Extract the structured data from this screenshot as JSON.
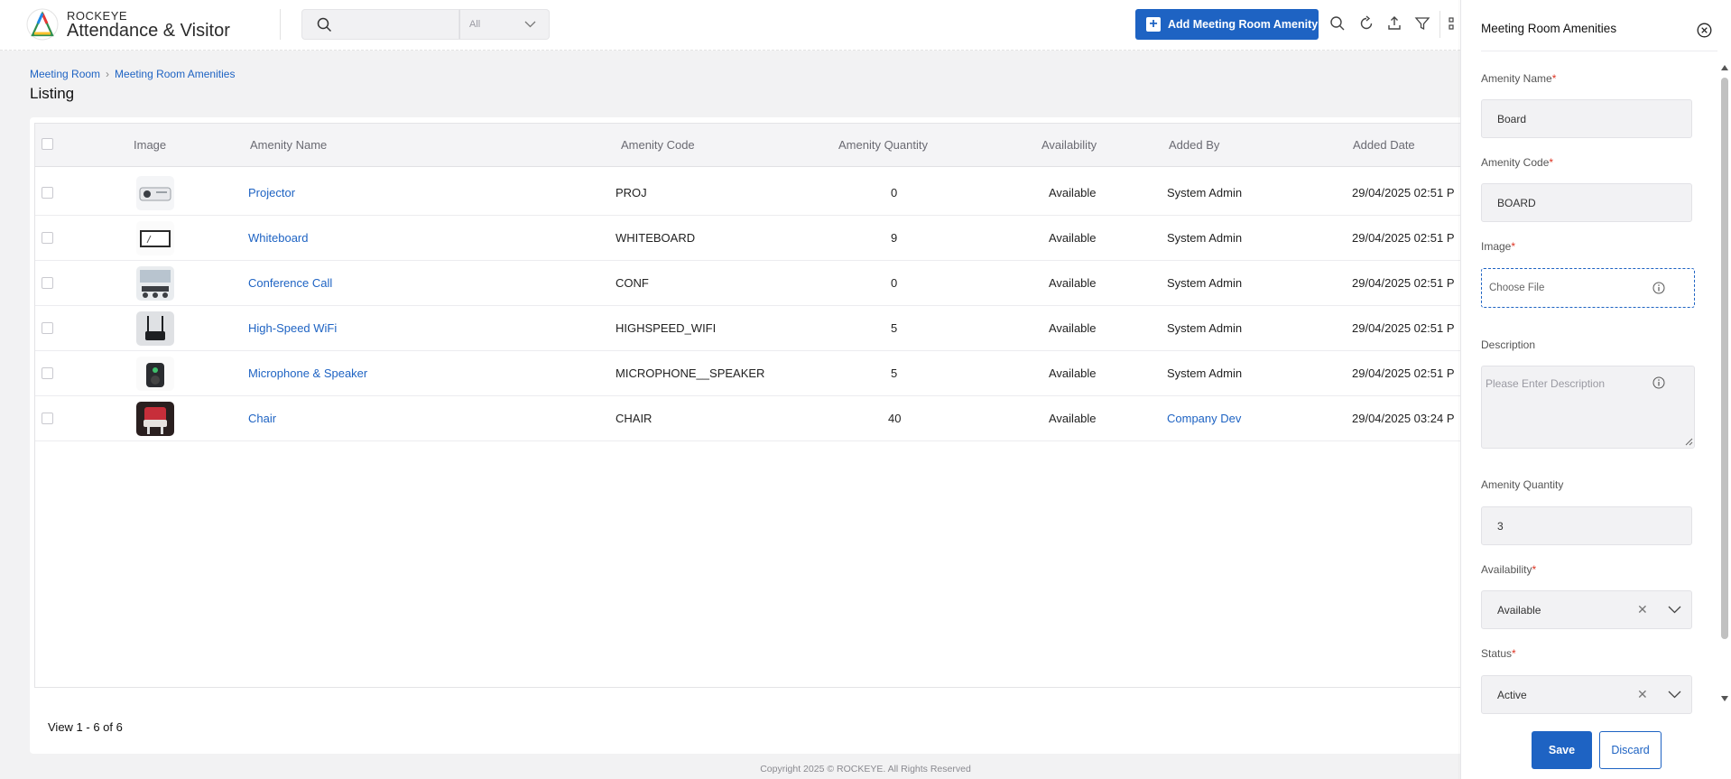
{
  "header": {
    "brand_top": "ROCKEYE",
    "brand_main": "Attendance & Visitor",
    "search_placeholder": "",
    "search_scope": "All",
    "add_button": "Add Meeting Room Amenity"
  },
  "breadcrumb": [
    "Meeting Room",
    "Meeting Room Amenities"
  ],
  "page_title": "Listing",
  "table": {
    "columns": [
      "Image",
      "Amenity Name",
      "Amenity Code",
      "Amenity Quantity",
      "Availability",
      "Added By",
      "Added Date"
    ],
    "rows": [
      {
        "image": "projector-image",
        "name": "Projector",
        "code": "PROJ",
        "quantity": "0",
        "availability": "Available",
        "added_by": "System Admin",
        "added_date": "29/04/2025 02:51 P"
      },
      {
        "image": "whiteboard-image",
        "name": "Whiteboard",
        "code": "WHITEBOARD",
        "quantity": "9",
        "availability": "Available",
        "added_by": "System Admin",
        "added_date": "29/04/2025 02:51 P"
      },
      {
        "image": "conference-call-image",
        "name": "Conference Call",
        "code": "CONF",
        "quantity": "0",
        "availability": "Available",
        "added_by": "System Admin",
        "added_date": "29/04/2025 02:51 P"
      },
      {
        "image": "wifi-router-image",
        "name": "High-Speed WiFi",
        "code": "HIGHSPEED_WIFI",
        "quantity": "5",
        "availability": "Available",
        "added_by": "System Admin",
        "added_date": "29/04/2025 02:51 P"
      },
      {
        "image": "speaker-image",
        "name": "Microphone & Speaker",
        "code": "MICROPHONE__SPEAKER",
        "quantity": "5",
        "availability": "Available",
        "added_by": "System Admin",
        "added_date": "29/04/2025 02:51 P"
      },
      {
        "image": "chair-image",
        "name": "Chair",
        "code": "CHAIR",
        "quantity": "40",
        "availability": "Available",
        "added_by": "Company Dev",
        "added_date": "29/04/2025 03:24 P"
      }
    ],
    "footer": "View 1 - 6 of 6"
  },
  "copyright": "Copyright 2025 © ROCKEYE. All Rights Reserved",
  "panel": {
    "title": "Meeting Room Amenities",
    "amenity_name_label": "Amenity Name",
    "amenity_name_value": "Board",
    "amenity_code_label": "Amenity Code",
    "amenity_code_value": "BOARD",
    "image_label": "Image",
    "image_placeholder": "Choose File",
    "description_label": "Description",
    "description_placeholder": "Please Enter Description",
    "quantity_label": "Amenity Quantity",
    "quantity_value": "3",
    "availability_label": "Availability",
    "availability_value": "Available",
    "status_label": "Status",
    "status_value": "Active",
    "save_label": "Save",
    "discard_label": "Discard"
  },
  "colors": {
    "primary": "#1e63c3",
    "required": "#d32f2f"
  }
}
